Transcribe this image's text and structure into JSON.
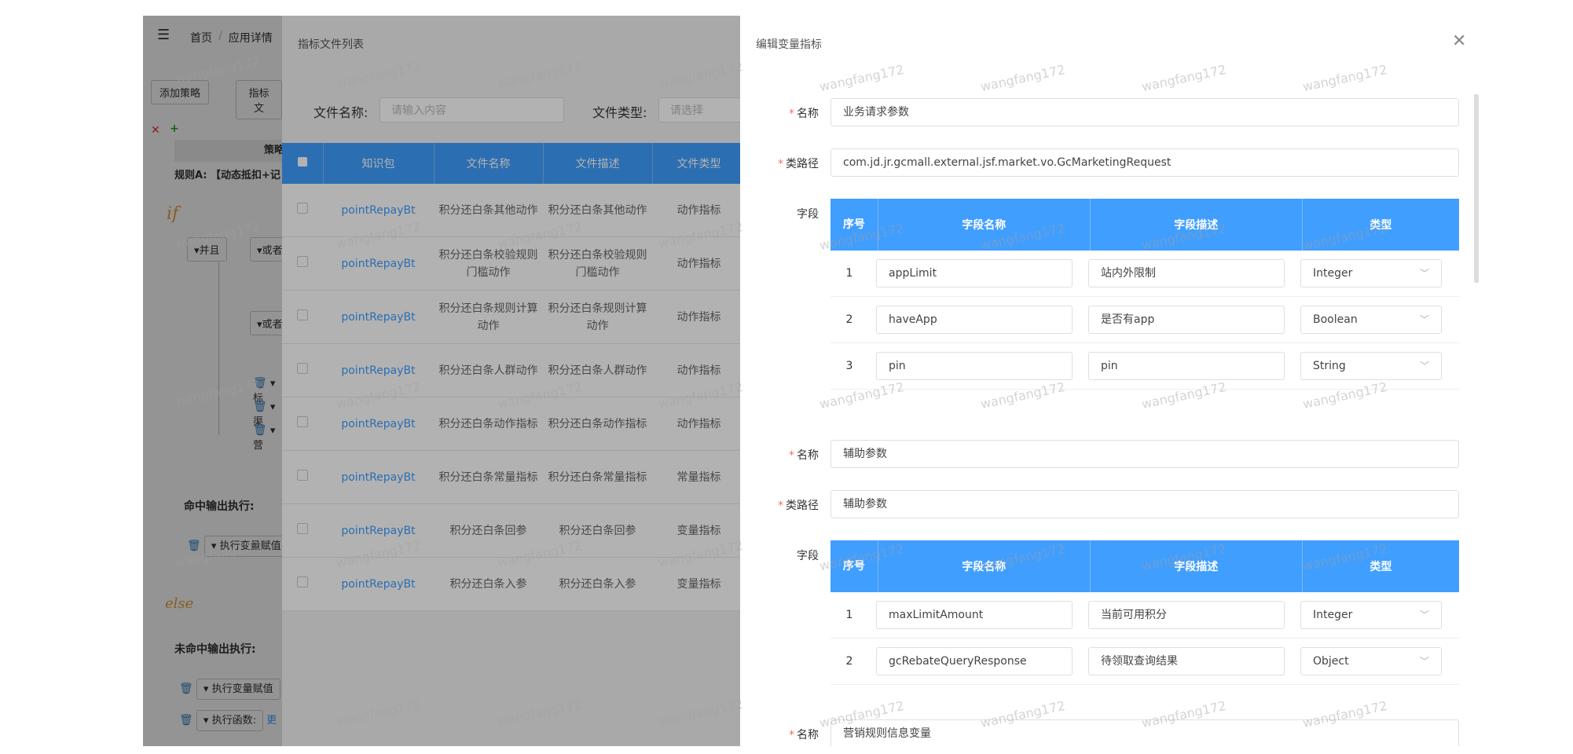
{
  "base": {
    "breadcrumb": {
      "home": "首页",
      "sep": "/",
      "current": "应用详情"
    },
    "buttons": {
      "add_strategy": "添加策略",
      "indicator_file": "指标文"
    },
    "strategy_head": "策略",
    "rule_line": "规则A: 【动态抵扣+记",
    "if_label": "if",
    "and_label": "▾并且",
    "or_label_1": "▾或者",
    "or_label_2": "▾或者",
    "small_items": [
      "▾标",
      "▾渠",
      "▾营"
    ],
    "hit_output_label": "命中输出执行:",
    "hit_exec": "▾ 执行变量赋值",
    "else_label": "else",
    "miss_output_label": "未命中输出执行:",
    "miss_exec_1": "▾ 执行变量赋值",
    "miss_exec_2": "▾ 执行函数:",
    "miss_exec_2_extra": "更"
  },
  "list_panel": {
    "title": "指标文件列表",
    "filter_name_label": "文件名称:",
    "filter_name_placeholder": "请输入内容",
    "filter_type_label": "文件类型:",
    "filter_type_placeholder": "请选择",
    "columns": [
      "知识包",
      "文件名称",
      "文件描述",
      "文件类型"
    ],
    "rows": [
      {
        "pkg": "pointRepayBt",
        "name": "积分还白条其他动作",
        "desc": "积分还白条其他动作",
        "type": "动作指标"
      },
      {
        "pkg": "pointRepayBt",
        "name": "积分还白条校验规则门槛动作",
        "desc": "积分还白条校验规则门槛动作",
        "type": "动作指标"
      },
      {
        "pkg": "pointRepayBt",
        "name": "积分还白条规则计算动作",
        "desc": "积分还白条规则计算动作",
        "type": "动作指标"
      },
      {
        "pkg": "pointRepayBt",
        "name": "积分还白条人群动作",
        "desc": "积分还白条人群动作",
        "type": "动作指标"
      },
      {
        "pkg": "pointRepayBt",
        "name": "积分还白条动作指标",
        "desc": "积分还白条动作指标",
        "type": "动作指标"
      },
      {
        "pkg": "pointRepayBt",
        "name": "积分还白条常量指标",
        "desc": "积分还白条常量指标",
        "type": "常量指标"
      },
      {
        "pkg": "pointRepayBt",
        "name": "积分还白条回参",
        "desc": "积分还白条回参",
        "type": "变量指标"
      },
      {
        "pkg": "pointRepayBt",
        "name": "积分还白条入参",
        "desc": "积分还白条入参",
        "type": "变量指标"
      }
    ]
  },
  "edit_panel": {
    "title": "编辑变量指标",
    "labels": {
      "name": "名称",
      "class_path": "类路径",
      "fields": "字段",
      "required_mark": "*"
    },
    "table_columns": [
      "序号",
      "字段名称",
      "字段描述",
      "类型"
    ],
    "groups": [
      {
        "name": "业务请求参数",
        "class_path": "com.jd.jr.gcmall.external.jsf.market.vo.GcMarketingRequest",
        "fields": [
          {
            "no": "1",
            "field": "appLimit",
            "desc": "站内外限制",
            "type": "Integer"
          },
          {
            "no": "2",
            "field": "haveApp",
            "desc": "是否有app",
            "type": "Boolean"
          },
          {
            "no": "3",
            "field": "pin",
            "desc": "pin",
            "type": "String"
          }
        ]
      },
      {
        "name": "辅助参数",
        "class_path": "辅助参数",
        "fields": [
          {
            "no": "1",
            "field": "maxLimitAmount",
            "desc": "当前可用积分",
            "type": "Integer"
          },
          {
            "no": "2",
            "field": "gcRebateQueryResponse",
            "desc": "待领取查询结果",
            "type": "Object"
          }
        ]
      },
      {
        "name": "营销规则信息变量"
      }
    ]
  },
  "watermark": "wangfang172",
  "colors": {
    "primary": "#409eff",
    "required": "#f56c6c",
    "link": "#409eff"
  },
  "icons": {
    "menu": "menu-icon",
    "close": "close-icon",
    "trash": "trash-icon",
    "chevron": "chevron-down-icon"
  }
}
